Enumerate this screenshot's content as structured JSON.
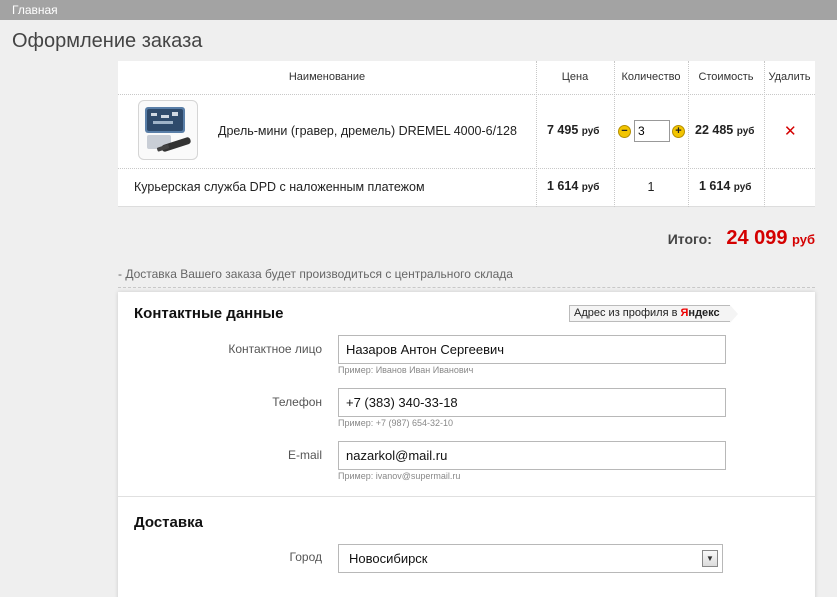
{
  "nav": {
    "home_label": "Главная"
  },
  "page": {
    "title": "Оформление заказа"
  },
  "cart": {
    "headers": {
      "name": "Наименование",
      "price": "Цена",
      "quantity": "Количество",
      "cost": "Стоимость",
      "delete": "Удалить"
    },
    "items": [
      {
        "name": "Дрель-мини (гравер, дремель) DREMEL 4000-6/128",
        "price": "7 495",
        "currency": "руб",
        "quantity": "3",
        "cost": "22 485",
        "cost_currency": "руб",
        "minus_label": "−",
        "plus_label": "+",
        "delete_label": "✕"
      }
    ],
    "delivery_row": {
      "name": "Курьерская служба DPD с наложенным платежом",
      "price": "1 614",
      "currency": "руб",
      "quantity": "1",
      "cost": "1 614",
      "cost_currency": "руб"
    }
  },
  "total": {
    "label": "Итого:",
    "value": "24 099",
    "currency": "руб"
  },
  "note": "- Доставка Вашего заказа будет производиться с центрального склада",
  "contacts": {
    "title": "Контактные данные",
    "yandex_button": {
      "text": "Адрес из профиля в",
      "brand_y": "Я",
      "brand_rest": "ндекс"
    },
    "fields": [
      {
        "label": "Контактное лицо",
        "value": "Назаров Антон Сергеевич",
        "hint": "Пример: Иванов Иван Иванович"
      },
      {
        "label": "Телефон",
        "value": "+7 (383) 340-33-18",
        "hint": "Пример: +7 (987) 654-32-10"
      },
      {
        "label": "E-mail",
        "value": "nazarkol@mail.ru",
        "hint": "Пример: ivanov@supermail.ru"
      }
    ]
  },
  "delivery": {
    "title": "Доставка",
    "city_label": "Город",
    "city_value": "Новосибирск",
    "arrow_label": "▼"
  },
  "colors": {
    "accent_red": "#d40000",
    "topbar": "#a3a3a3",
    "qty_button": "#f3c500"
  }
}
